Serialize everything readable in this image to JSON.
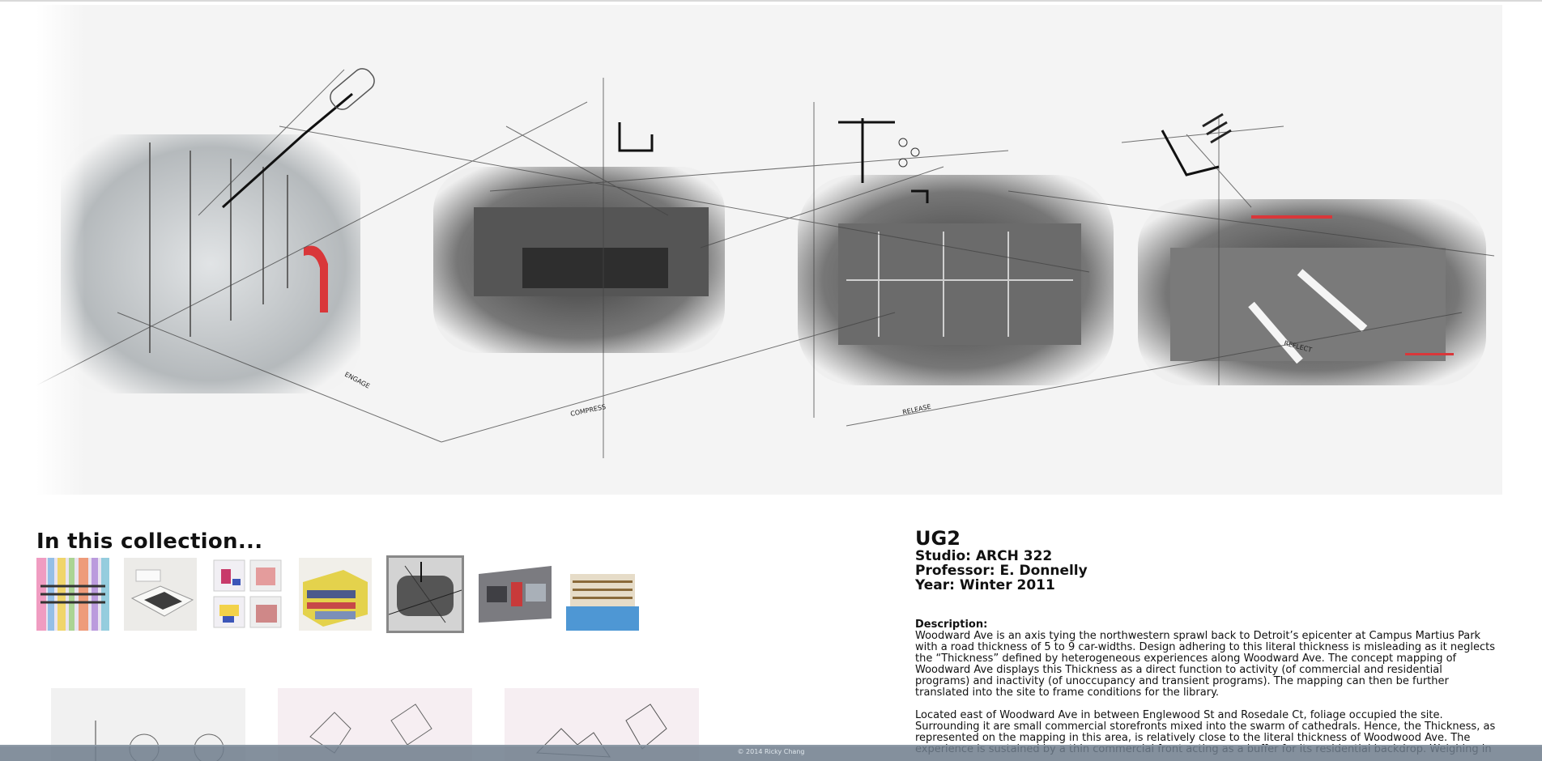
{
  "hero": {
    "labels": [
      "ENGAGE",
      "COMPRESS",
      "RELEASE",
      "REFLECT"
    ]
  },
  "collection": {
    "heading": "In this collection...",
    "thumbnails": [
      {
        "name": "thumb-1",
        "selected": false
      },
      {
        "name": "thumb-2",
        "selected": false
      },
      {
        "name": "thumb-3",
        "selected": false
      },
      {
        "name": "thumb-4",
        "selected": false
      },
      {
        "name": "thumb-5",
        "selected": true
      },
      {
        "name": "thumb-6",
        "selected": false
      },
      {
        "name": "thumb-7",
        "selected": false
      }
    ]
  },
  "project": {
    "title": "UG2",
    "studio": "Studio: ARCH 322",
    "professor": "Professor: E. Donnelly",
    "year": "Year: Winter 2011",
    "description_label": "Description:",
    "paragraph1": "Woodward Ave is an axis tying the northwestern sprawl back to Detroit’s epicenter at Campus Martius Park with a road thickness of 5 to 9 car-widths. Design adhering to this literal thickness is misleading as it neglects the “Thickness” defined by heterogeneous experiences along Woodward Ave. The concept mapping of Woodward Ave displays this Thickness as a direct function to activity (of commercial and residential programs) and inactivity (of unoccupancy and transient programs). The mapping can then be further translated into the site to frame conditions for the library.",
    "paragraph2": "Located east of Woodward Ave in between Englewood St and Rosedale Ct, foliage occupied the site. Surrounding it are small commercial storefronts mixed into the swarm of cathedrals. Hence, the Thickness, as represented on the mapping in this area, is relatively close to the literal thickness of Woodwood Ave. The experience is sustained by a thin commercial front acting as a buffer for its residential backdrop. Weighing in"
  },
  "footer": {
    "text": "© 2014 Ricky Chang"
  },
  "colors": {
    "accent_red": "#d9373a",
    "footer_bar": "#6e7d8c"
  }
}
